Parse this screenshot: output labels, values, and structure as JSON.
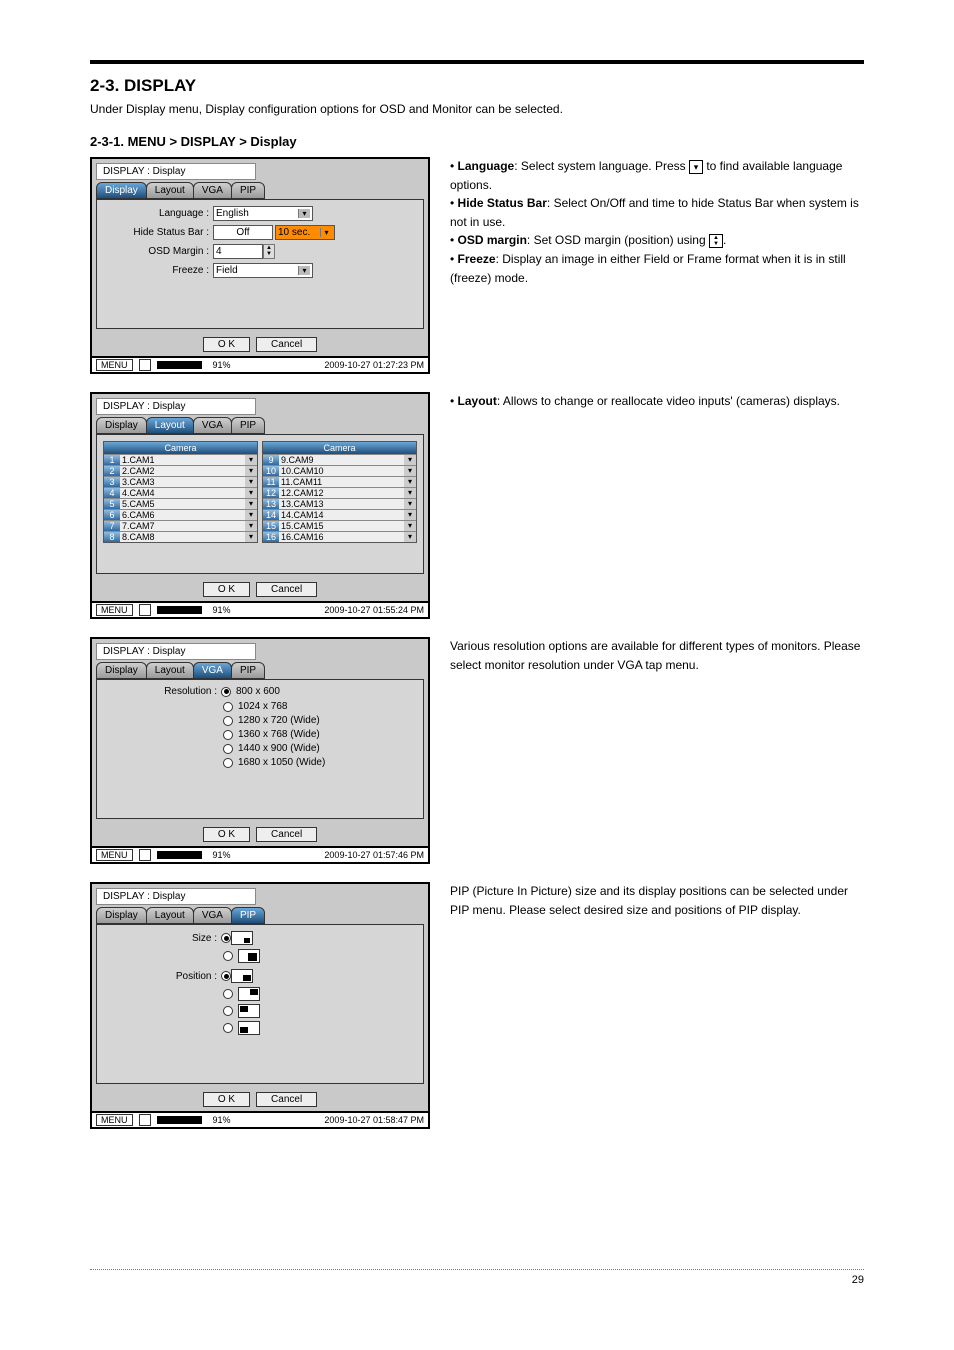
{
  "section": {
    "title": "2-3. DISPLAY",
    "intro": "Under Display menu, Display configuration options for OSD and Monitor can be selected.",
    "subtitle": "2-3-1. MENU > DISPLAY > Display"
  },
  "page_number": "29",
  "common": {
    "win_title": "DISPLAY : Display",
    "tabs": {
      "display": "Display",
      "layout": "Layout",
      "vga": "VGA",
      "pip": "PIP"
    },
    "ok": "O K",
    "cancel": "Cancel",
    "menu": "MENU",
    "pct": "91%",
    "timestamps": {
      "display": "2009-10-27 01:27:23 PM",
      "layout": "2009-10-27 01:55:24 PM",
      "vga": "2009-10-27 01:57:46 PM",
      "pip": "2009-10-27 01:58:47 PM"
    }
  },
  "display_tab": {
    "fields": {
      "language": {
        "label": "Language :",
        "value": "English"
      },
      "hide_status": {
        "label": "Hide Status Bar :",
        "onoff": "Off",
        "time": "10 sec."
      },
      "osd_margin": {
        "label": "OSD Margin :",
        "value": "4"
      },
      "freeze": {
        "label": "Freeze :",
        "value": "Field"
      }
    }
  },
  "layout_tab": {
    "col_head": "Camera",
    "left": [
      {
        "idx": "1",
        "name": "1.CAM1"
      },
      {
        "idx": "2",
        "name": "2.CAM2"
      },
      {
        "idx": "3",
        "name": "3.CAM3"
      },
      {
        "idx": "4",
        "name": "4.CAM4"
      },
      {
        "idx": "5",
        "name": "5.CAM5"
      },
      {
        "idx": "6",
        "name": "6.CAM6"
      },
      {
        "idx": "7",
        "name": "7.CAM7"
      },
      {
        "idx": "8",
        "name": "8.CAM8"
      }
    ],
    "right": [
      {
        "idx": "9",
        "name": "9.CAM9"
      },
      {
        "idx": "10",
        "name": "10.CAM10"
      },
      {
        "idx": "11",
        "name": "11.CAM11"
      },
      {
        "idx": "12",
        "name": "12.CAM12"
      },
      {
        "idx": "13",
        "name": "13.CAM13"
      },
      {
        "idx": "14",
        "name": "14.CAM14"
      },
      {
        "idx": "15",
        "name": "15.CAM15"
      },
      {
        "idx": "16",
        "name": "16.CAM16"
      }
    ]
  },
  "vga_tab": {
    "label": "Resolution :",
    "options": [
      "800 x 600",
      "1024 x 768",
      "1280 x 720 (Wide)",
      "1360 x 768 (Wide)",
      "1440 x 900 (Wide)",
      "1680 x 1050 (Wide)"
    ]
  },
  "pip_tab": {
    "size_label": "Size :",
    "position_label": "Position :"
  },
  "desc": {
    "display": {
      "language_b": "Language",
      "language_t": ": Select system language. Press",
      "language_t2": "to find available language options.",
      "hide_b": "Hide Status Bar",
      "hide_t": ": Select On/Off and time to hide Status Bar when system is not in use.",
      "osd_b": "OSD margin",
      "osd_t": ": Set OSD margin (position) using",
      "freeze_b": "Freeze",
      "freeze_t": ": Display an image in either Field or Frame format when it is in still (freeze) mode."
    },
    "layout": {
      "b": "Layout",
      "t": ": Allows to change or reallocate video inputs' (cameras) displays."
    },
    "vga": "Various resolution options are available for different types of monitors. Please select monitor resolution under VGA tap menu.",
    "pip": "PIP (Picture In Picture) size and its display positions can be selected under PIP menu. Please select desired size and positions of PIP display."
  }
}
